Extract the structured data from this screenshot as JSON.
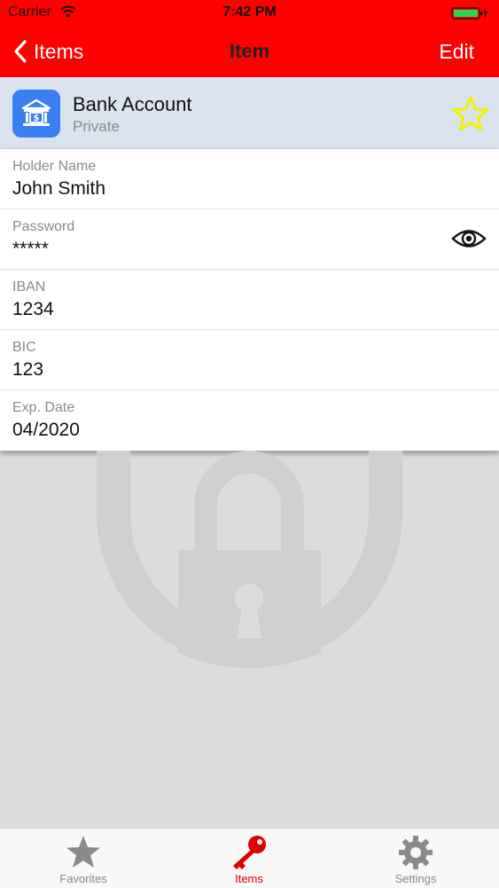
{
  "status_bar": {
    "carrier": "Carrier",
    "time": "7:42 PM"
  },
  "nav": {
    "back_label": "Items",
    "title": "Item",
    "edit_label": "Edit"
  },
  "header": {
    "name": "Bank Account",
    "subtitle": "Private",
    "icon": "bank-icon",
    "favorite_icon": "star-outline-icon"
  },
  "fields": [
    {
      "label": "Holder Name",
      "value": "John Smith"
    },
    {
      "label": "Password",
      "value": "*****"
    },
    {
      "label": "IBAN",
      "value": "1234"
    },
    {
      "label": "BIC",
      "value": "123"
    },
    {
      "label": "Exp. Date",
      "value": "04/2020"
    }
  ],
  "tabs": [
    {
      "label": "Favorites",
      "icon": "star-icon"
    },
    {
      "label": "Items",
      "icon": "key-icon",
      "active": true
    },
    {
      "label": "Settings",
      "icon": "gear-icon"
    }
  ],
  "colors": {
    "nav_bar": "#ff0000",
    "accent": "#e00000",
    "header_bg": "#dbe3ef",
    "app_icon_bg": "#3b7ef2",
    "star": "#f2f200",
    "battery": "#2fd24a"
  }
}
